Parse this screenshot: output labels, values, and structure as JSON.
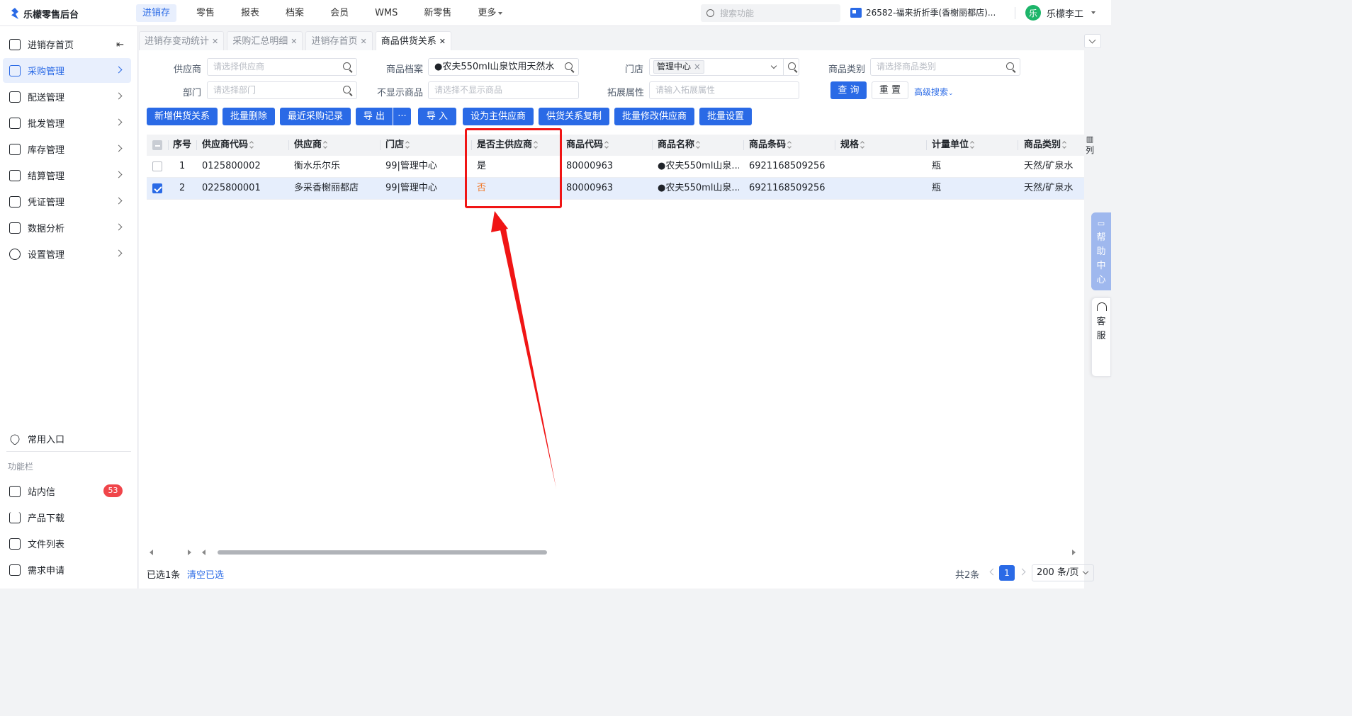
{
  "app": {
    "title": "乐檬零售后台"
  },
  "topnav": {
    "items": [
      "进销存",
      "零售",
      "报表",
      "档案",
      "会员",
      "WMS",
      "新零售",
      "更多"
    ],
    "active": 0
  },
  "top_search": {
    "placeholder": "搜索功能"
  },
  "store": {
    "label": "26582-福来折折季(香榭丽都店)..."
  },
  "user": {
    "avatar": "乐",
    "name": "乐檬李工"
  },
  "sidebar": {
    "items": [
      {
        "label": "进销存首页",
        "icon": "home-icon"
      },
      {
        "label": "采购管理",
        "icon": "cart-icon"
      },
      {
        "label": "配送管理",
        "icon": "truck-icon"
      },
      {
        "label": "批发管理",
        "icon": "batch-icon"
      },
      {
        "label": "库存管理",
        "icon": "stock-icon"
      },
      {
        "label": "结算管理",
        "icon": "money-icon"
      },
      {
        "label": "凭证管理",
        "icon": "voucher-icon"
      },
      {
        "label": "数据分析",
        "icon": "chart-icon"
      },
      {
        "label": "设置管理",
        "icon": "settings-icon"
      }
    ],
    "active": 1,
    "favorites": "常用入口",
    "section_title": "功能栏",
    "bottom": [
      {
        "label": "站内信",
        "icon": "mail-icon",
        "badge": "53"
      },
      {
        "label": "产品下载",
        "icon": "download-icon"
      },
      {
        "label": "文件列表",
        "icon": "file-list-icon"
      },
      {
        "label": "需求申请",
        "icon": "request-icon"
      }
    ]
  },
  "tabs": [
    "进销存变动统计",
    "采购汇总明细",
    "进销存首页",
    "商品供货关系"
  ],
  "active_tab": 3,
  "filters": {
    "supplier": {
      "label": "供应商",
      "placeholder": "请选择供应商"
    },
    "product": {
      "label": "商品档案",
      "value": "●农夫550ml山泉饮用天然水"
    },
    "store": {
      "label": "门店",
      "tag": "管理中心"
    },
    "category": {
      "label": "商品类别",
      "placeholder": "请选择商品类别"
    },
    "dept": {
      "label": "部门",
      "placeholder": "请选择部门"
    },
    "hidden": {
      "label": "不显示商品",
      "placeholder": "请选择不显示商品"
    },
    "ext": {
      "label": "拓展属性",
      "placeholder": "请输入拓展属性"
    },
    "query": "查 询",
    "reset": "重 置",
    "advanced": "高级搜索"
  },
  "toolbar": [
    "新增供货关系",
    "批量删除",
    "最近采购记录",
    "导 出",
    "···",
    "导 入",
    "设为主供应商",
    "供货关系复制",
    "批量修改供应商",
    "批量设置"
  ],
  "table": {
    "columns": [
      "序号",
      "供应商代码",
      "供应商",
      "门店",
      "是否主供应商",
      "商品代码",
      "商品名称",
      "商品条码",
      "规格",
      "计量单位",
      "商品类别"
    ],
    "rows": [
      {
        "no": "1",
        "supplier_code": "0125800002",
        "supplier": "衡水乐尔乐",
        "store": "99|管理中心",
        "main": "是",
        "product_code": "80000963",
        "product_name": "●农夫550ml山泉...",
        "barcode": "6921168509256",
        "spec": "",
        "unit": "瓶",
        "category": "天然/矿泉水",
        "checked": false
      },
      {
        "no": "2",
        "supplier_code": "0225800001",
        "supplier": "多采香榭丽都店",
        "store": "99|管理中心",
        "main": "否",
        "product_code": "80000963",
        "product_name": "●农夫550ml山泉...",
        "barcode": "6921168509256",
        "spec": "",
        "unit": "瓶",
        "category": "天然/矿泉水",
        "checked": true
      }
    ],
    "column_toggle": "列"
  },
  "footer": {
    "selected": "已选1条",
    "clear": "清空已选",
    "total": "共2条",
    "page": "1",
    "page_size": "200 条/页"
  },
  "float": {
    "help": [
      "帮",
      "助",
      "中",
      "心"
    ],
    "service": [
      "客",
      "服"
    ]
  },
  "colors": {
    "accent": "#2a6ae6",
    "highlight": "#f01515",
    "no_value": "#f07a2b"
  }
}
